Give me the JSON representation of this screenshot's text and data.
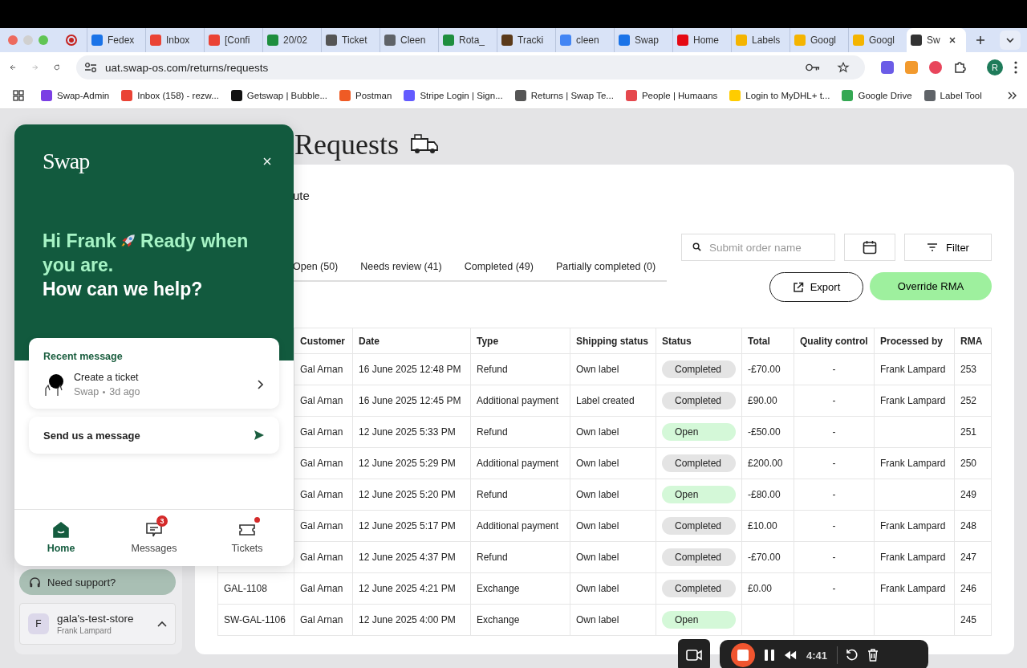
{
  "browser": {
    "tabs": [
      {
        "label": "Fedex",
        "color": "#1a73e8",
        "selected": false
      },
      {
        "label": "Inbox",
        "color": "#ea4335",
        "selected": false
      },
      {
        "label": "[Confi",
        "color": "#ea4335",
        "selected": false
      },
      {
        "label": "20/02",
        "color": "#1e8e3e",
        "selected": false
      },
      {
        "label": "Ticket",
        "color": "#555555",
        "selected": false
      },
      {
        "label": "Cleen",
        "color": "#5f6368",
        "selected": false
      },
      {
        "label": "Rota_",
        "color": "#1e8e3e",
        "selected": false
      },
      {
        "label": "Tracki",
        "color": "#5b3a1a",
        "selected": false
      },
      {
        "label": "cleen",
        "color": "#4285f4",
        "selected": false
      },
      {
        "label": "Swap",
        "color": "#1a73e8",
        "selected": false
      },
      {
        "label": "Home",
        "color": "#e50914",
        "selected": false
      },
      {
        "label": "Labels",
        "color": "#f4b400",
        "selected": false
      },
      {
        "label": "Googl",
        "color": "#f4b400",
        "selected": false
      },
      {
        "label": "Googl",
        "color": "#f4b400",
        "selected": false
      },
      {
        "label": "Sw",
        "color": "#333333",
        "selected": true
      }
    ],
    "url": "uat.swap-os.com/returns/requests",
    "profile_initial": "R",
    "bookmarks": [
      {
        "label": "Swap-Admin",
        "color": "#7b3fe4"
      },
      {
        "label": "Inbox (158) - rezw...",
        "color": "#ea4335"
      },
      {
        "label": "Getswap | Bubble...",
        "color": "#111111"
      },
      {
        "label": "Postman",
        "color": "#ef5b25"
      },
      {
        "label": "Stripe Login | Sign...",
        "color": "#635bff"
      },
      {
        "label": "Returns | Swap Te...",
        "color": "#555555"
      },
      {
        "label": "People | Humaans",
        "color": "#e5484d"
      },
      {
        "label": "Login to MyDHL+ t...",
        "color": "#ffcc00"
      },
      {
        "label": "Google Drive",
        "color": "#34a853"
      },
      {
        "label": "Label Tool",
        "color": "#5f6368"
      }
    ]
  },
  "sidebar": {
    "support": "Need support?",
    "store": {
      "initial": "F",
      "name": "gala's-test-store",
      "user": "Frank Lampard"
    }
  },
  "page": {
    "title": "Requests",
    "subtitle": "ute",
    "search": {
      "placeholder": "Submit order name"
    },
    "filter": "Filter",
    "export": "Export",
    "override": "Override RMA",
    "tabs": [
      {
        "label": "Open (50)",
        "selected": false
      },
      {
        "label": "Needs review (41)",
        "selected": false
      },
      {
        "label": "Completed (49)",
        "selected": false
      },
      {
        "label": "Partially completed (0)",
        "selected": false
      }
    ],
    "table": {
      "columns": [
        "Customer",
        "Date",
        "Type",
        "Shipping status",
        "Status",
        "Total",
        "Quality control",
        "Processed by",
        "RMA"
      ],
      "rows": [
        {
          "customer": "Gal Arnan",
          "date": "16 June 2025 12:48 PM",
          "type": "Refund",
          "shipping": "Own label",
          "status": {
            "label": "Completed",
            "kind": "completed"
          },
          "total": "-£70.00",
          "qc": "-",
          "processed_by": "Frank Lampard",
          "rma": "253"
        },
        {
          "customer": "Gal Arnan",
          "date": "16 June 2025 12:45 PM",
          "type": "Additional payment",
          "shipping": "Label created",
          "status": {
            "label": "Completed",
            "kind": "completed"
          },
          "total": "£90.00",
          "qc": "-",
          "processed_by": "Frank Lampard",
          "rma": "252"
        },
        {
          "customer": "Gal Arnan",
          "date": "12 June 2025 5:33 PM",
          "type": "Refund",
          "shipping": "Own label",
          "status": {
            "label": "Open",
            "kind": "open"
          },
          "total": "-£50.00",
          "qc": "-",
          "rma": "251"
        },
        {
          "customer": "Gal Arnan",
          "date": "12 June 2025 5:29 PM",
          "type": "Additional payment",
          "shipping": "Own label",
          "status": {
            "label": "Completed",
            "kind": "completed"
          },
          "total": "£200.00",
          "qc": "-",
          "processed_by": "Frank Lampard",
          "rma": "250"
        },
        {
          "customer": "Gal Arnan",
          "date": "12 June 2025 5:20 PM",
          "type": "Refund",
          "shipping": "Own label",
          "status": {
            "label": "Open",
            "kind": "open"
          },
          "total": "-£80.00",
          "qc": "-",
          "rma": "249"
        },
        {
          "customer": "Gal Arnan",
          "date": "12 June 2025 5:17 PM",
          "type": "Additional payment",
          "shipping": "Own label",
          "status": {
            "label": "Completed",
            "kind": "completed"
          },
          "total": "£10.00",
          "qc": "-",
          "processed_by": "Frank Lampard",
          "rma": "248"
        },
        {
          "customer": "Gal Arnan",
          "date": "12 June 2025 4:37 PM",
          "type": "Refund",
          "shipping": "Own label",
          "status": {
            "label": "Completed",
            "kind": "completed"
          },
          "total": "-£70.00",
          "qc": "-",
          "processed_by": "Frank Lampard",
          "rma": "247"
        },
        {
          "order": "GAL-1108",
          "customer": "Gal Arnan",
          "date": "12 June 2025 4:21 PM",
          "type": "Exchange",
          "shipping": "Own label",
          "status": {
            "label": "Completed",
            "kind": "completed"
          },
          "total": "£0.00",
          "qc": "-",
          "processed_by": "Frank Lampard",
          "rma": "246"
        },
        {
          "order": "SW-GAL-1106",
          "customer": "Gal Arnan",
          "date": "12 June 2025 4:00 PM",
          "type": "Exchange",
          "shipping": "Own label",
          "status": {
            "label": "Open",
            "kind": "open"
          },
          "rma": "245"
        }
      ]
    }
  },
  "widget": {
    "logo": "Swap",
    "greeting_start": "Hi Frank",
    "greeting_end": "Ready when",
    "greeting_line2": "you are.",
    "question": "How can we help?",
    "recent": {
      "heading": "Recent message",
      "title": "Create a ticket",
      "sender": "Swap",
      "time": "3d ago"
    },
    "send": "Send us a message",
    "nav": [
      {
        "label": "Home",
        "kind": "home",
        "selected": true
      },
      {
        "label": "Messages",
        "kind": "messages",
        "badge": "3",
        "selected": false
      },
      {
        "label": "Tickets",
        "kind": "tickets",
        "unread": true,
        "selected": false
      }
    ]
  },
  "recorder": {
    "time": "4:41"
  }
}
